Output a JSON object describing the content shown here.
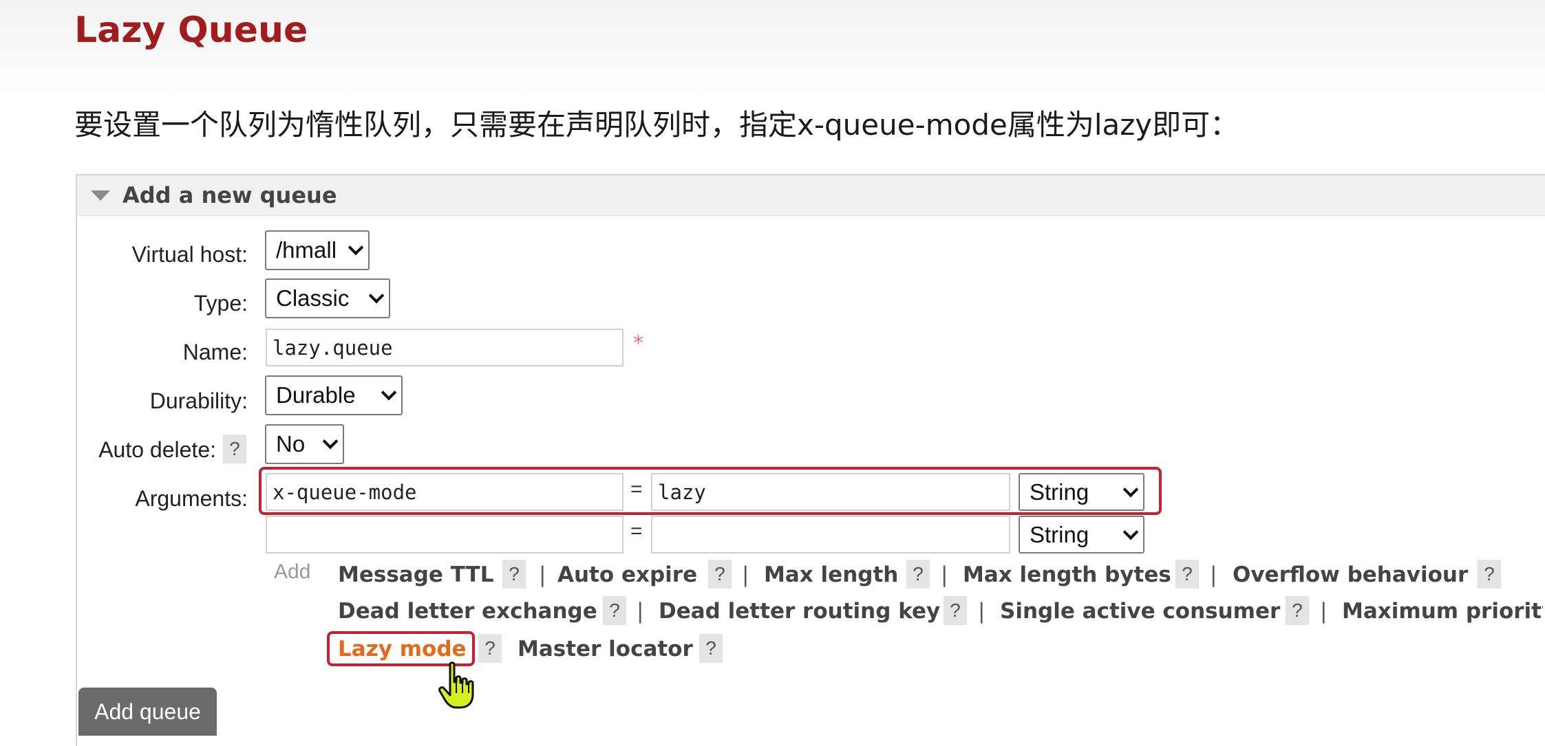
{
  "doc": {
    "title": "Lazy Queue",
    "paragraph": "要设置一个队列为惰性队列，只需要在声明队列时，指定x-queue-mode属性为lazy即可："
  },
  "panel": {
    "title": "Add a new queue",
    "virtual_host": {
      "label": "Virtual host:",
      "value": "/hmall"
    },
    "type": {
      "label": "Type:",
      "value": "Classic"
    },
    "name": {
      "label": "Name:",
      "value": "lazy.queue",
      "required_mark": "*"
    },
    "durability": {
      "label": "Durability:",
      "value": "Durable"
    },
    "auto_delete": {
      "label": "Auto delete:",
      "help": "?",
      "value": "No"
    },
    "arguments": {
      "label": "Arguments:",
      "rows": [
        {
          "key": "x-queue-mode",
          "eq": "=",
          "value": "lazy",
          "type": "String"
        },
        {
          "key": "",
          "eq": "=",
          "value": "",
          "type": "String"
        }
      ]
    },
    "add_label": "Add",
    "shortcuts": {
      "message_ttl": "Message TTL",
      "auto_expire": "Auto expire",
      "max_length": "Max length",
      "max_length_bytes": "Max length bytes",
      "overflow_behaviour": "Overflow behaviour",
      "dead_letter_exchange": "Dead letter exchange",
      "dead_letter_routing_key": "Dead letter routing key",
      "single_active_consumer": "Single active consumer",
      "maximum_priority": "Maximum priority",
      "lazy_mode": "Lazy mode",
      "master_locator": "Master locator"
    },
    "help": "?",
    "separator": "|",
    "submit_label": "Add queue"
  },
  "colors": {
    "title_red": "#a11d1d",
    "highlight_red": "#cc1e2e",
    "lazy_orange": "#e36a1a",
    "cursor_yellow": "#d4f020"
  }
}
